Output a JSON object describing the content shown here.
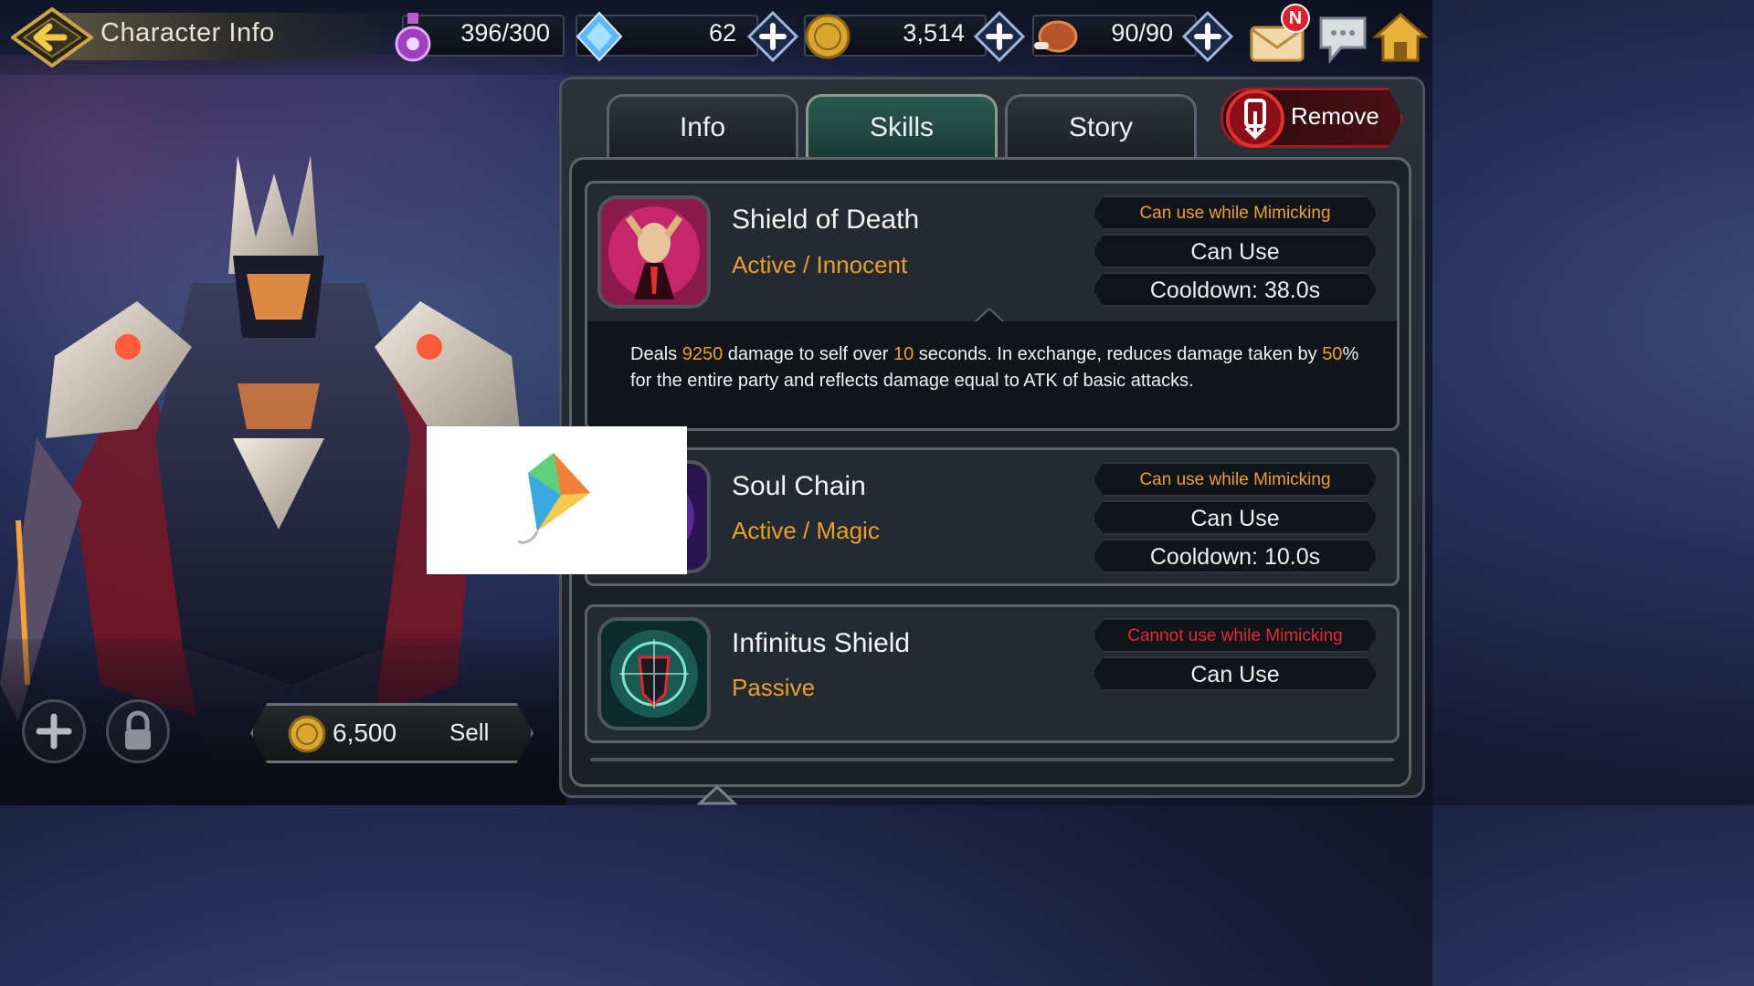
{
  "header": {
    "title": "Character Info",
    "stamina": "396/300",
    "gems": "62",
    "gold": "3,514",
    "food": "90/90",
    "mail_badge": "N"
  },
  "tabs": [
    {
      "label": "Info",
      "active": false
    },
    {
      "label": "Skills",
      "active": true
    },
    {
      "label": "Story",
      "active": false
    }
  ],
  "remove_label": "Remove",
  "skills": [
    {
      "name": "Shield of Death",
      "type": "Active / Innocent",
      "mimic": "Can use while Mimicking",
      "usable": "Can Use",
      "cooldown": "Cooldown: 38.0s",
      "description": {
        "p1": "Deals ",
        "v1": "9250",
        "p2": " damage to self over ",
        "v2": "10",
        "p3": " seconds. In exchange, reduces damage taken by ",
        "v3": "50",
        "p4": "% for the entire party and reflects damage equal to ATK of basic attacks."
      }
    },
    {
      "name": "Soul Chain",
      "type": "Active / Magic",
      "mimic": "Can use while Mimicking",
      "usable": "Can Use",
      "cooldown": "Cooldown: 10.0s"
    },
    {
      "name": "Infinitus Shield",
      "type": "Passive",
      "mimic": "Cannot use while Mimicking",
      "usable": "Can Use"
    }
  ],
  "sell": {
    "price": "6,500",
    "label": "Sell"
  },
  "colors": {
    "accent_orange": "#e99f2a",
    "warning_red": "#e22d2d",
    "active_tab": "#2a5a50"
  },
  "icons": [
    "back-arrow-icon",
    "stamina-potion-icon",
    "gem-icon",
    "gold-coin-icon",
    "meat-icon",
    "plus-icon",
    "mail-icon",
    "chat-icon",
    "home-icon",
    "remove-icon",
    "lock-icon",
    "add-icon",
    "kite-logo-icon"
  ]
}
